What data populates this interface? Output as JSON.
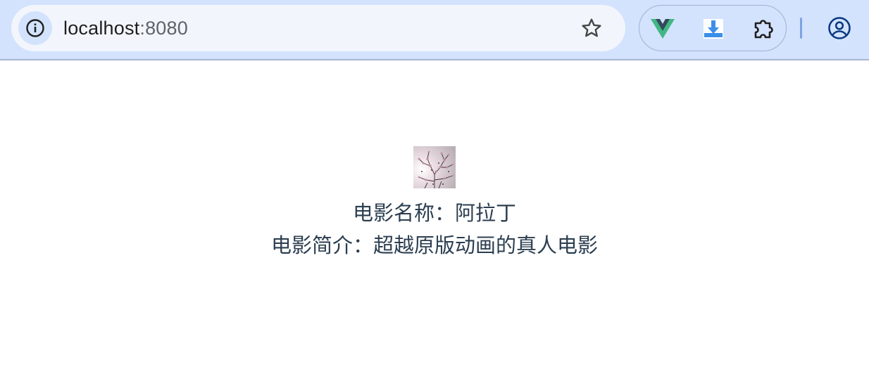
{
  "browser": {
    "url_host": "localhost",
    "url_port": ":8080",
    "icons": {
      "site_info": "info-icon",
      "bookmark": "star-icon",
      "extensions": [
        "vue-devtools-icon",
        "download-extension-icon",
        "puzzle-icon"
      ],
      "profile": "profile-icon"
    },
    "colors": {
      "toolbar": "#d3e3fd",
      "omnibox": "#f2f6fc",
      "text": "#2c3e50"
    }
  },
  "movie": {
    "image_name": "cherry-blossom-poster",
    "name_line": "电影名称：阿拉丁",
    "desc_line": "电影简介：超越原版动画的真人电影"
  }
}
